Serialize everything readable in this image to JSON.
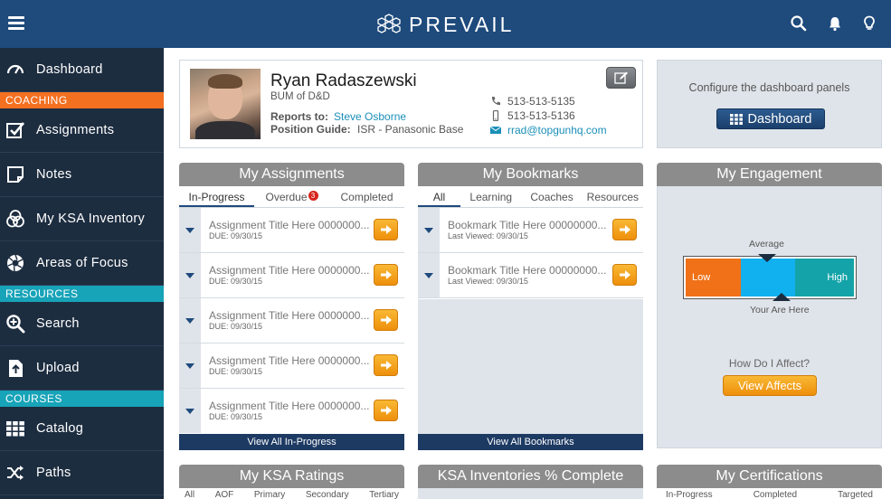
{
  "app": {
    "logo_text": "PREVAIL"
  },
  "sidebar": {
    "items": [
      {
        "label": "Dashboard",
        "icon": "speedometer-icon"
      },
      {
        "section": "COACHING",
        "color": "#f37021"
      },
      {
        "label": "Assignments",
        "icon": "checkbox-icon"
      },
      {
        "label": "Notes",
        "icon": "note-icon"
      },
      {
        "label": "My KSA Inventory",
        "icon": "venn-icon"
      },
      {
        "label": "Areas of Focus",
        "icon": "aperture-icon"
      },
      {
        "section": "RESOURCES",
        "color": "#17a3b8"
      },
      {
        "label": "Search",
        "icon": "search-plus-icon"
      },
      {
        "label": "Upload",
        "icon": "upload-icon"
      },
      {
        "section": "COURSES",
        "color": "#17a3b8"
      },
      {
        "label": "Catalog",
        "icon": "grid-icon"
      },
      {
        "label": "Paths",
        "icon": "shuffle-icon"
      }
    ]
  },
  "profile": {
    "name": "Ryan Radaszewski",
    "title": "BUM of D&D",
    "reports_to_label": "Reports to:",
    "reports_to": "Steve Osborne",
    "position_guide_label": "Position Guide:",
    "position_guide": "ISR - Panasonic Base",
    "phone": "513-513-5135",
    "mobile": "513-513-5136",
    "email": "rrad@topgunhq.com"
  },
  "config": {
    "text": "Configure the dashboard panels",
    "button": "Dashboard"
  },
  "assignments": {
    "title": "My Assignments",
    "tabs": [
      "In-Progress",
      "Overdue",
      "Completed"
    ],
    "overdue_count": "3",
    "items": [
      {
        "title": "Assignment Title Here 0000000...",
        "due": "DUE: 09/30/15"
      },
      {
        "title": "Assignment Title Here 0000000...",
        "due": "DUE: 09/30/15"
      },
      {
        "title": "Assignment Title Here 0000000...",
        "due": "DUE: 09/30/15"
      },
      {
        "title": "Assignment Title Here 0000000...",
        "due": "DUE: 09/30/15"
      },
      {
        "title": "Assignment Title Here 0000000...",
        "due": "DUE: 09/30/15"
      }
    ],
    "view_all": "View All In-Progress"
  },
  "bookmarks": {
    "title": "My Bookmarks",
    "tabs": [
      "All",
      "Learning",
      "Coaches",
      "Resources"
    ],
    "items": [
      {
        "title": "Bookmark Title Here 00000000...",
        "viewed": "Last Viewed: 09/30/15"
      },
      {
        "title": "Bookmark Title Here 00000000...",
        "viewed": "Last Viewed: 09/30/15"
      }
    ],
    "view_all": "View All Bookmarks"
  },
  "engagement": {
    "title": "My Engagement",
    "average_label": "Average",
    "low": "Low",
    "high": "High",
    "you_are_here": "Your Are Here",
    "question": "How Do I Affect?",
    "button": "View Affects"
  },
  "bottom_panels": {
    "ksa_ratings": {
      "title": "My KSA Ratings",
      "tabs": [
        "All",
        "AOF",
        "Primary",
        "Secondary",
        "Tertiary"
      ]
    },
    "ksa_inventories": {
      "title": "KSA Inventories % Complete"
    },
    "certifications": {
      "title": "My Certifications",
      "tabs": [
        "In-Progress",
        "Completed",
        "Targeted"
      ]
    }
  },
  "colors": {
    "topbar": "#1e4a7c",
    "sidebar": "#1d2d40",
    "orange_section": "#f37021",
    "teal_section": "#17a3b8",
    "link": "#1a8fb8",
    "go_button": "#f2a01f"
  }
}
